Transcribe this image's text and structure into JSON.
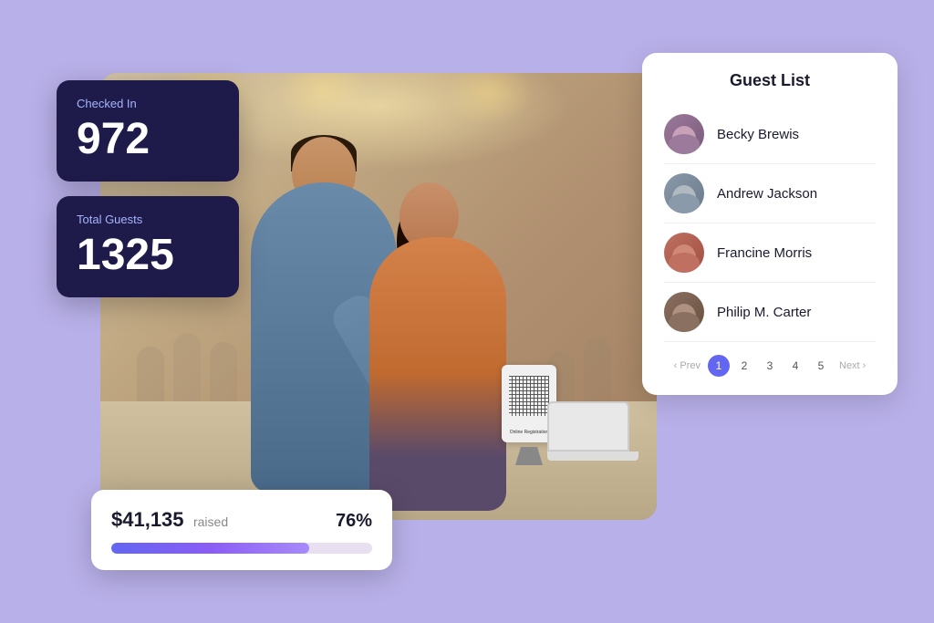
{
  "background": {
    "color": "#b8b0e8"
  },
  "checkedIn": {
    "label": "Checked In",
    "value": "972"
  },
  "totalGuests": {
    "label": "Total Guests",
    "value": "1325"
  },
  "fundraising": {
    "amount": "$41,135",
    "raised_label": "raised",
    "percent": "76%",
    "progress_width": "76"
  },
  "guestList": {
    "title": "Guest List",
    "guests": [
      {
        "id": "becky",
        "name": "Becky Brewis",
        "avatar_class": "avatar-becky"
      },
      {
        "id": "andrew",
        "name": "Andrew Jackson",
        "avatar_class": "avatar-andrew"
      },
      {
        "id": "francine",
        "name": "Francine Morris",
        "avatar_class": "avatar-francine"
      },
      {
        "id": "philip",
        "name": "Philip M. Carter",
        "avatar_class": "avatar-philip"
      }
    ],
    "pagination": {
      "prev_label": "‹ Prev",
      "next_label": "Next ›",
      "pages": [
        "1",
        "2",
        "3",
        "4",
        "5"
      ]
    }
  },
  "tablet": {
    "label": "Online\nRegistration"
  }
}
